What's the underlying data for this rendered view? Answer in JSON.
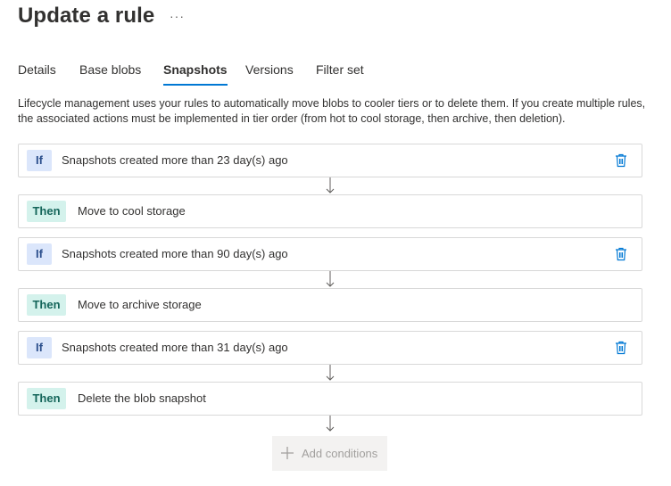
{
  "page": {
    "title": "Update a rule",
    "more_label": "···"
  },
  "tabs": [
    {
      "label": "Details"
    },
    {
      "label": "Base blobs"
    },
    {
      "label": "Snapshots"
    },
    {
      "label": "Versions"
    },
    {
      "label": "Filter set"
    }
  ],
  "active_tab": "Snapshots",
  "description": "Lifecycle management uses your rules to automatically move blobs to cooler tiers or to delete them. If you create multiple rules, the associated actions must be implemented in tier order (from hot to cool storage, then archive, then deletion).",
  "conditions": [
    {
      "if_label": "If",
      "if_text": "Snapshots created more than 23 day(s) ago",
      "then_label": "Then",
      "then_text": "Move to cool storage"
    },
    {
      "if_label": "If",
      "if_text": "Snapshots created more than 90 day(s) ago",
      "then_label": "Then",
      "then_text": "Move to archive storage"
    },
    {
      "if_label": "If",
      "if_text": "Snapshots created more than 31 day(s) ago",
      "then_label": "Then",
      "then_text": "Delete the blob snapshot"
    }
  ],
  "add_conditions": {
    "label": "Add conditions",
    "icon": "plus-icon",
    "disabled": true
  },
  "icons": {
    "delete": "trash-icon",
    "connector": "arrow-down-icon"
  },
  "colors": {
    "accent": "#0078d4",
    "if_badge_bg": "#dbe6fb",
    "then_badge_bg": "#d4f2ec",
    "trash": "#0078d4"
  }
}
